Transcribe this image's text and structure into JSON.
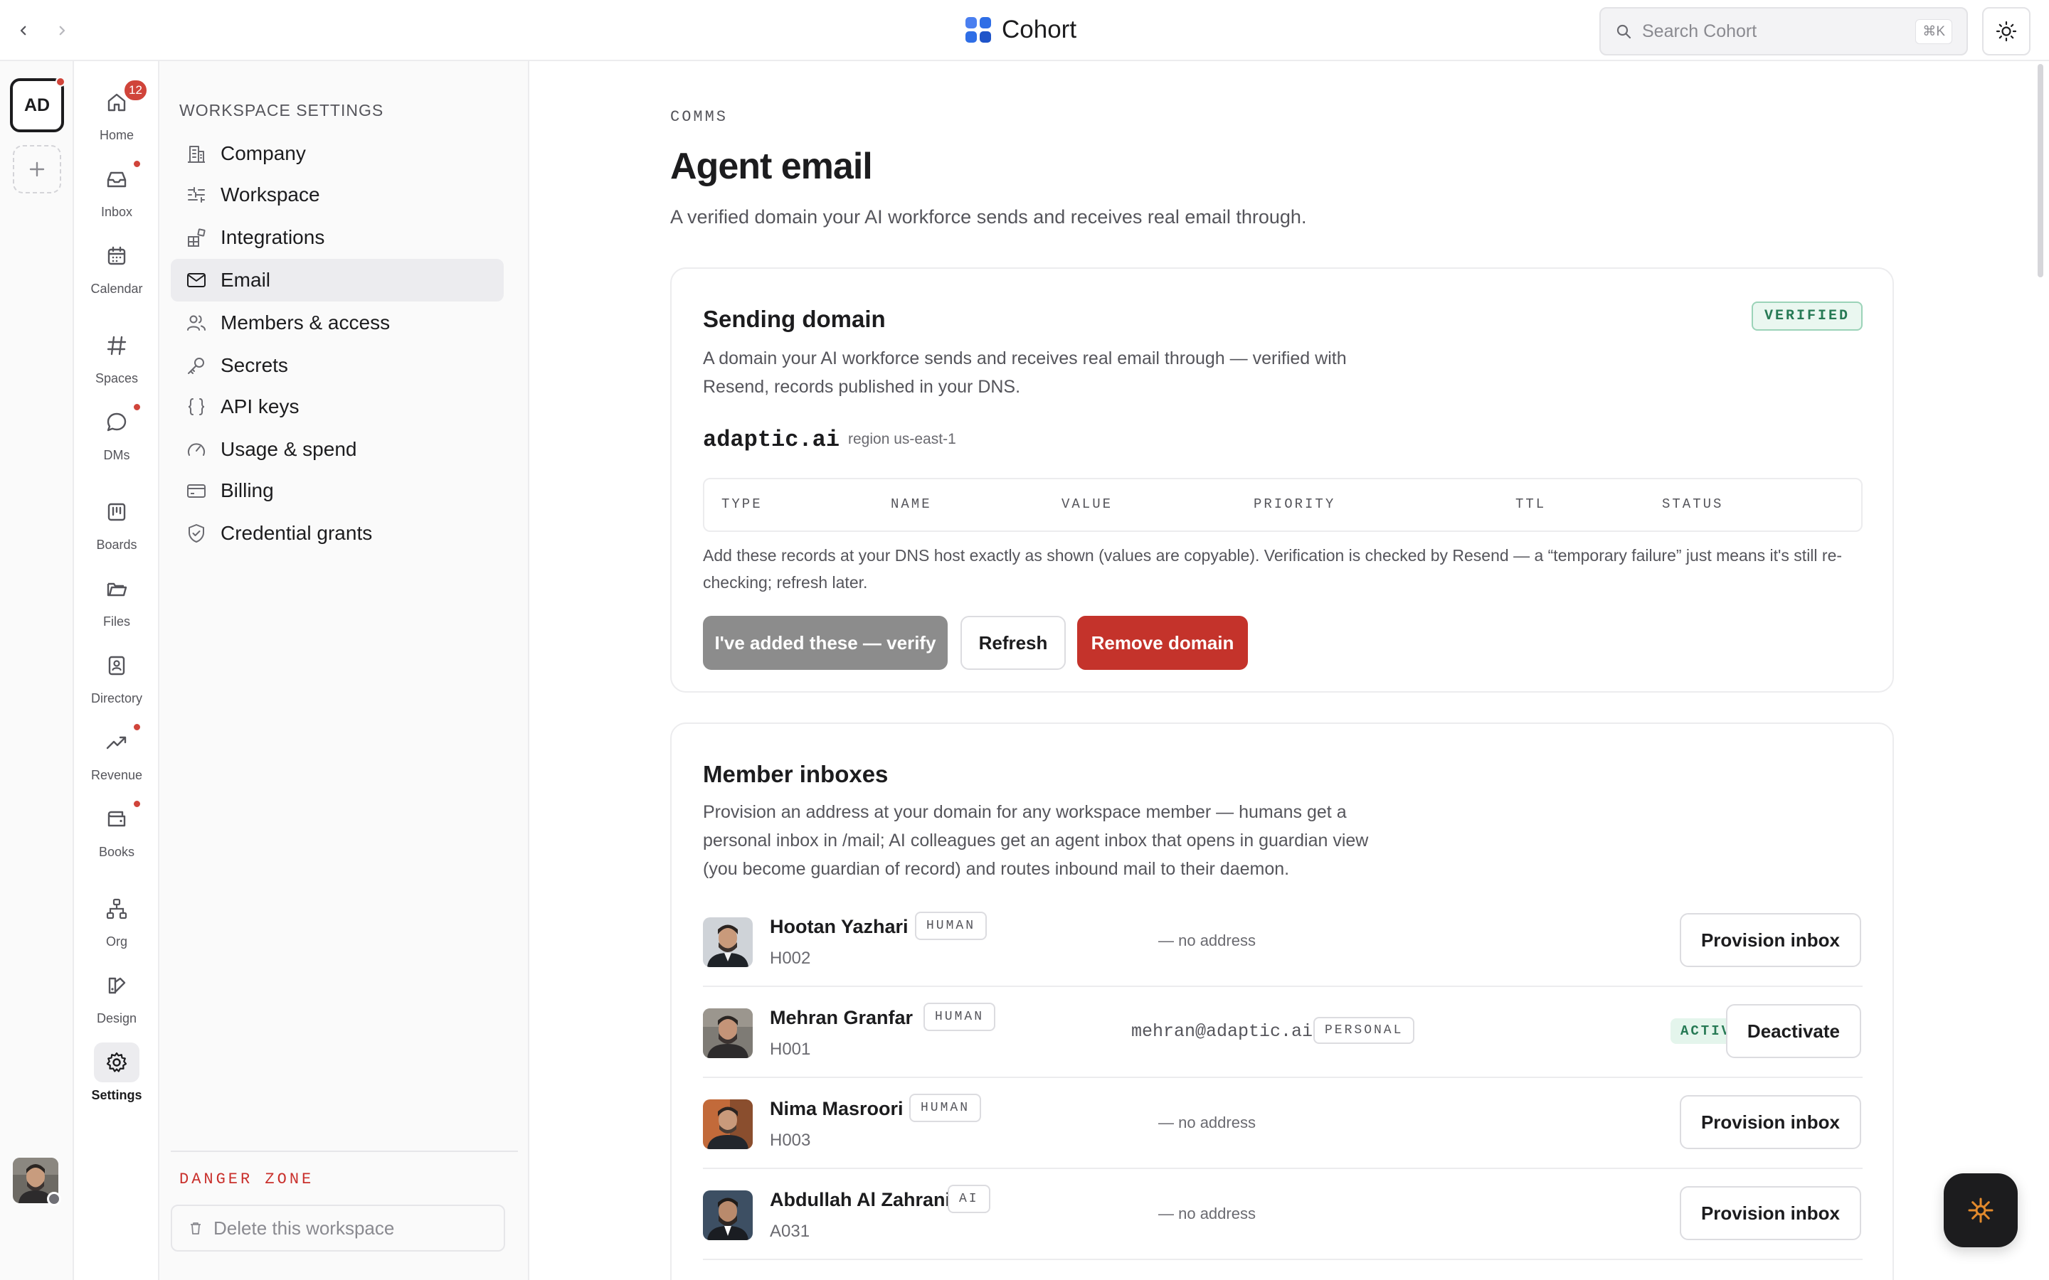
{
  "header": {
    "brand": "Cohort",
    "search_placeholder": "Search Cohort",
    "search_shortcut": "⌘K"
  },
  "workspace_rail": {
    "workspace_initials": "AD"
  },
  "app_nav": {
    "items": [
      {
        "label": "Home",
        "icon": "home-icon",
        "badge": "12"
      },
      {
        "label": "Inbox",
        "icon": "inbox-icon",
        "dot": true
      },
      {
        "label": "Calendar",
        "icon": "calendar-icon"
      },
      {
        "label": "Spaces",
        "icon": "hash-icon"
      },
      {
        "label": "DMs",
        "icon": "chat-bubble-icon",
        "dot": true
      },
      {
        "label": "Boards",
        "icon": "board-icon"
      },
      {
        "label": "Files",
        "icon": "folder-icon"
      },
      {
        "label": "Directory",
        "icon": "contact-book-icon"
      },
      {
        "label": "Revenue",
        "icon": "trend-up-icon",
        "dot": true
      },
      {
        "label": "Books",
        "icon": "wallet-icon",
        "dot": true
      },
      {
        "label": "Org",
        "icon": "org-chart-icon"
      },
      {
        "label": "Design",
        "icon": "design-icon"
      },
      {
        "label": "Settings",
        "icon": "gear-icon",
        "active": true
      }
    ]
  },
  "settings_nav": {
    "title": "WORKSPACE SETTINGS",
    "items": [
      {
        "label": "Company",
        "icon": "building-icon"
      },
      {
        "label": "Workspace",
        "icon": "sliders-icon"
      },
      {
        "label": "Integrations",
        "icon": "blocks-icon"
      },
      {
        "label": "Email",
        "icon": "mail-icon",
        "active": true
      },
      {
        "label": "Members & access",
        "icon": "users-icon"
      },
      {
        "label": "Secrets",
        "icon": "key-icon"
      },
      {
        "label": "API keys",
        "icon": "braces-icon"
      },
      {
        "label": "Usage & spend",
        "icon": "gauge-icon"
      },
      {
        "label": "Billing",
        "icon": "credit-card-icon"
      },
      {
        "label": "Credential grants",
        "icon": "shield-check-icon"
      }
    ],
    "danger_title": "DANGER ZONE",
    "delete_label": "Delete this workspace"
  },
  "page": {
    "eyebrow": "COMMS",
    "title": "Agent email",
    "subtitle": "A verified domain your AI workforce sends and receives real email through."
  },
  "sending_domain": {
    "title": "Sending domain",
    "status": "VERIFIED",
    "description_line1": "A domain your AI workforce sends and receives real email through — verified with",
    "description_line2": "Resend, records published in your DNS.",
    "domain": "adaptic.ai",
    "region": "region us-east-1",
    "columns": [
      "TYPE",
      "NAME",
      "VALUE",
      "PRIORITY",
      "TTL",
      "STATUS"
    ],
    "note": "Add these records at your DNS host exactly as shown (values are copyable). Verification is checked by Resend — a “temporary failure” just means it's still re-checking; refresh later.",
    "verify_label": "I've added these — verify",
    "refresh_label": "Refresh",
    "remove_label": "Remove domain"
  },
  "member_inboxes": {
    "title": "Member inboxes",
    "description_line1": "Provision an address at your domain for any workspace member — humans get a",
    "description_line2": "personal inbox in /mail; AI colleagues get an agent inbox that opens in guardian view",
    "description_line3": "(you become guardian of record) and routes inbound mail to their daemon.",
    "members": [
      {
        "name": "Hootan Yazhari",
        "type": "HUMAN",
        "id": "H002",
        "address": "— no address",
        "action": "Provision inbox"
      },
      {
        "name": "Mehran Granfar",
        "type": "HUMAN",
        "id": "H001",
        "address": "mehran@adaptic.ai",
        "address_tag": "PERSONAL",
        "status": "ACTIVE",
        "action": "Deactivate"
      },
      {
        "name": "Nima Masroori",
        "type": "HUMAN",
        "id": "H003",
        "address": "— no address",
        "action": "Provision inbox"
      },
      {
        "name": "Abdullah Al Zahrani",
        "type": "AI",
        "id": "A031",
        "address": "— no address",
        "action": "Provision inbox"
      }
    ]
  },
  "colors": {
    "accent_blue": "#2f6ee6",
    "danger_red": "#c4332b",
    "verified_green": "#277a55",
    "fab_icon": "#e38a2c"
  }
}
